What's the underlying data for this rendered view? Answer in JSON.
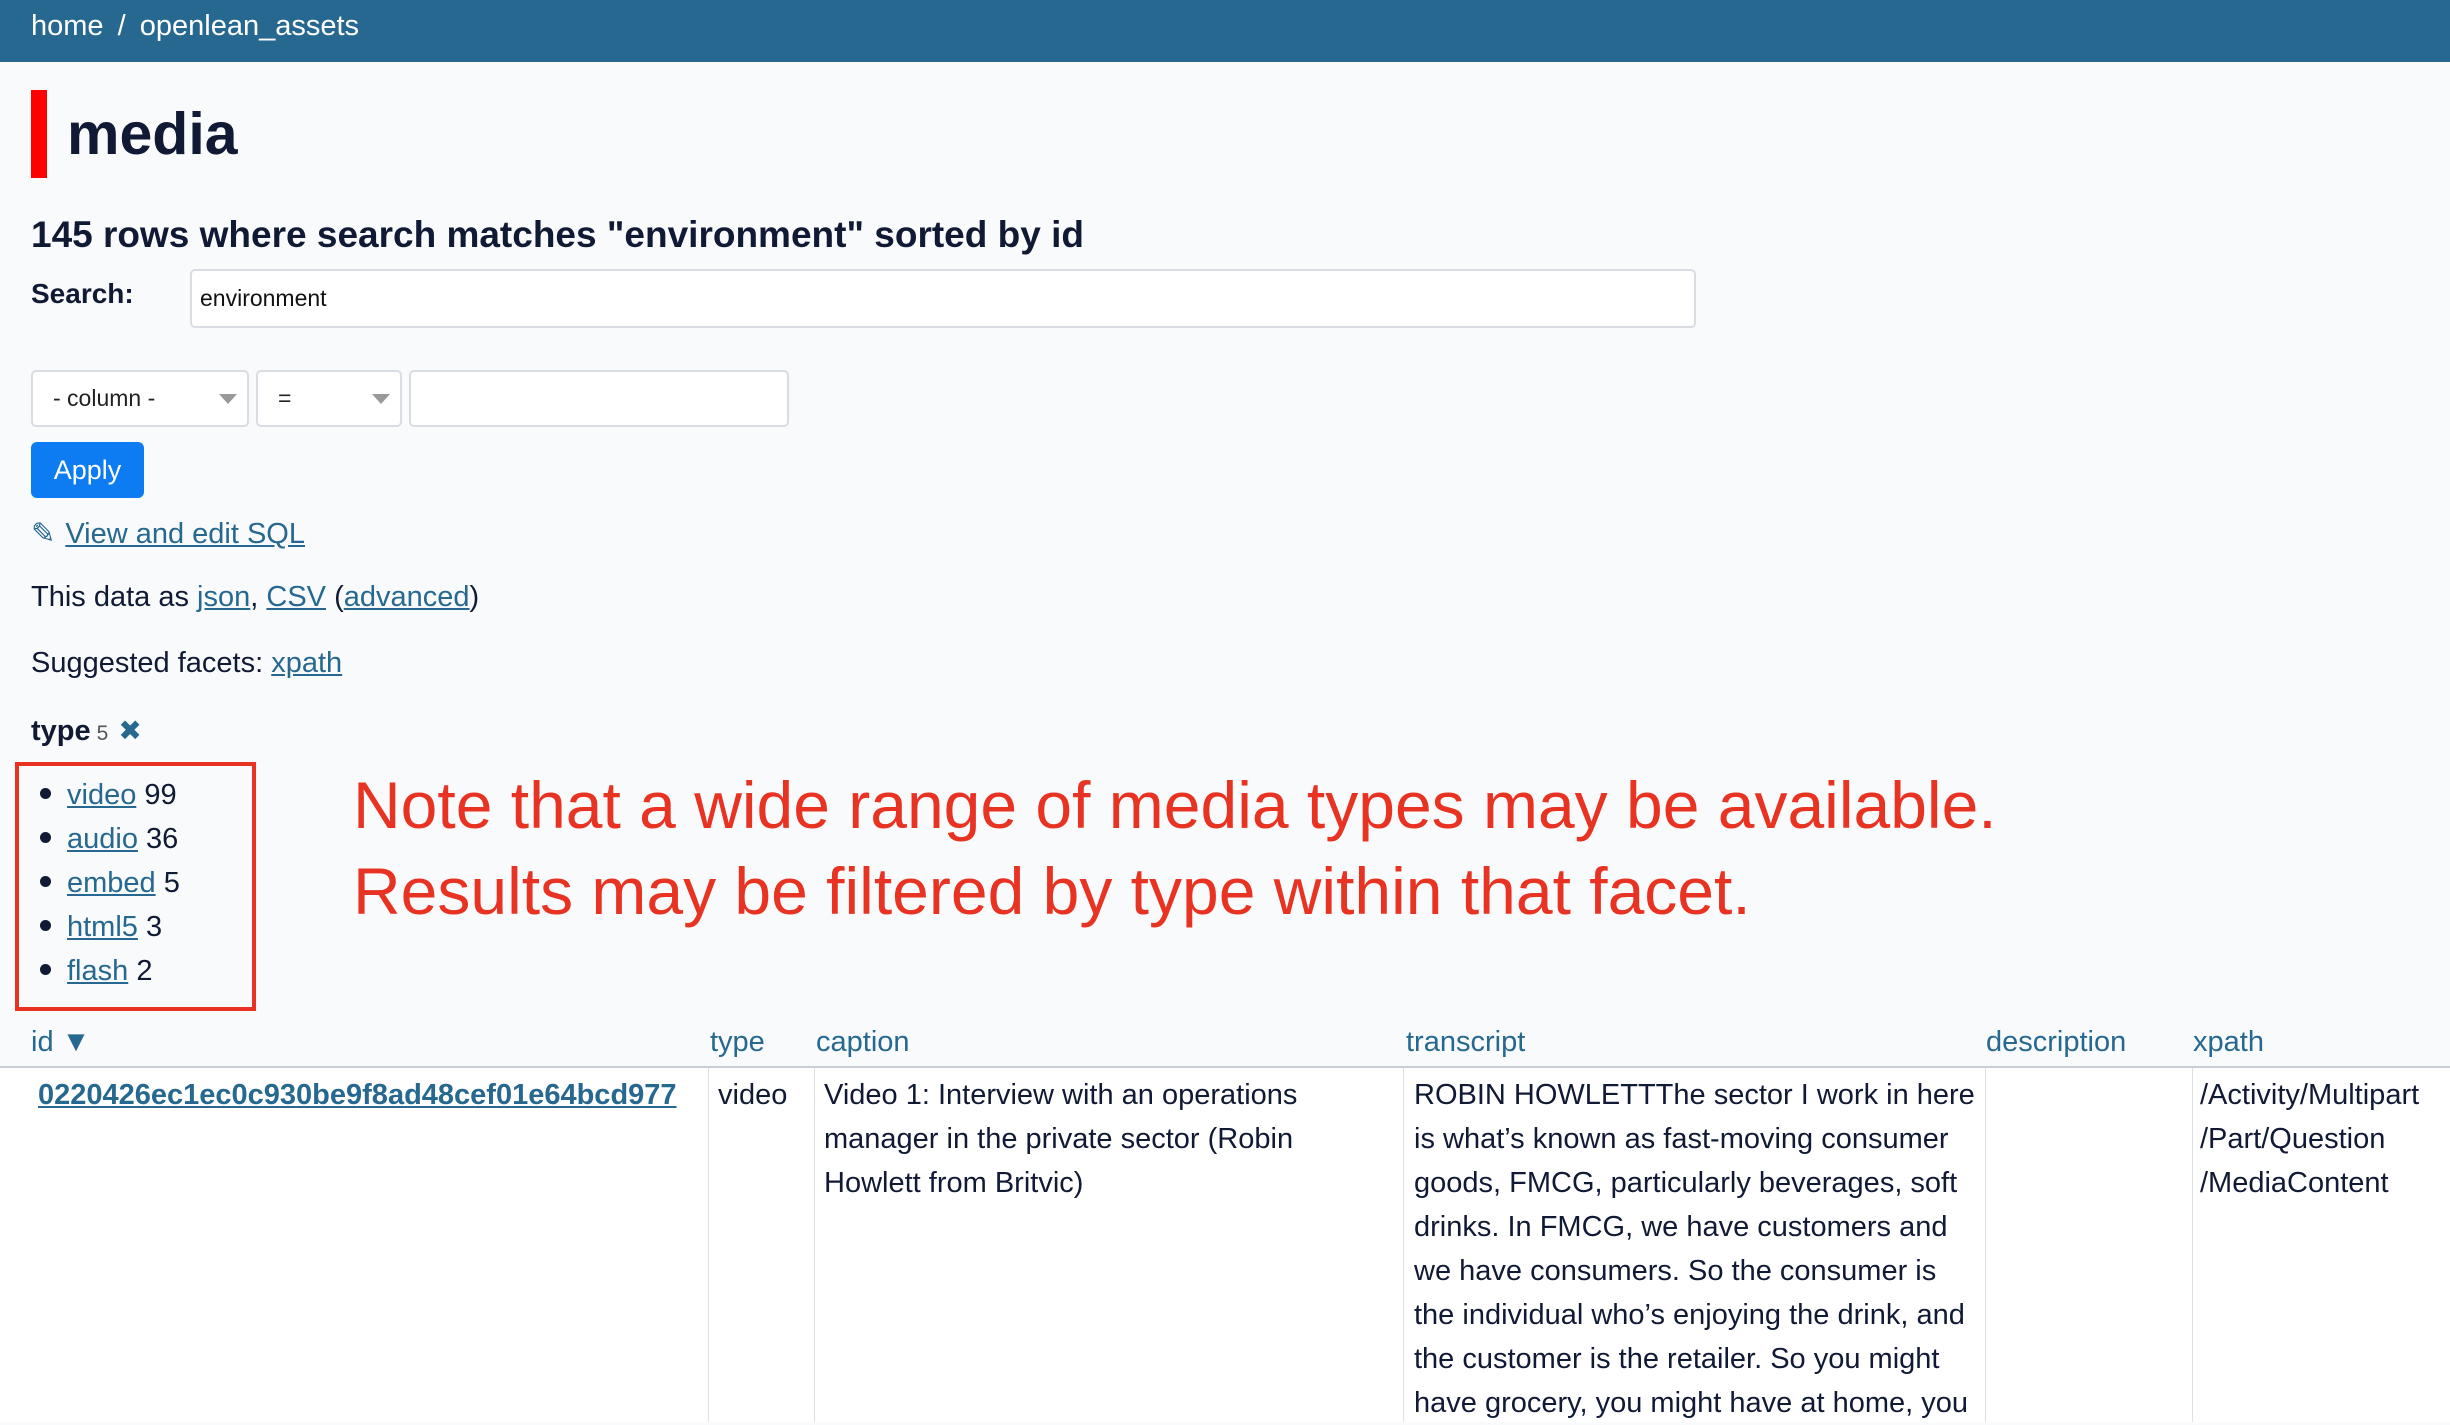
{
  "breadcrumb": {
    "home": "home",
    "separator": "/",
    "database": "openlean_assets"
  },
  "page_title": "media",
  "row_count_text": "145 rows where search matches \"environment\" sorted by id",
  "search": {
    "label": "Search:",
    "value": "environment"
  },
  "filter": {
    "column_select": "- column -",
    "operator_select": "=",
    "value": ""
  },
  "apply_label": "Apply",
  "sql": {
    "pencil": "✎",
    "link": "View and edit SQL"
  },
  "export": {
    "prefix": "This data as",
    "json": "json",
    "comma": ",",
    "csv": "CSV",
    "open_paren": "(",
    "advanced": "advanced",
    "close_paren": ")"
  },
  "suggested_facets": {
    "label": "Suggested facets:",
    "xpath": "xpath"
  },
  "facet": {
    "name": "type",
    "count": "5",
    "close_glyph": "✖",
    "items": [
      {
        "label": "video",
        "count": "99"
      },
      {
        "label": "audio",
        "count": "36"
      },
      {
        "label": "embed",
        "count": "5"
      },
      {
        "label": "html5",
        "count": "3"
      },
      {
        "label": "flash",
        "count": "2"
      }
    ]
  },
  "annotation": {
    "line1": "Note that a wide range of media types may be available.",
    "line2": "Results may be filtered by type within that facet.",
    "color": "#e83323"
  },
  "table": {
    "columns": [
      "id ▼",
      "type",
      "caption",
      "transcript",
      "description",
      "xpath"
    ],
    "row": {
      "id": "0220426ec1ec0c930be9f8ad48cef01e64bcd977",
      "type": "video",
      "caption": [
        "Video 1: Interview with an operations",
        "manager in the private sector (Robin",
        "Howlett from Britvic)"
      ],
      "transcript": [
        "ROBIN HOWLETTThe sector I work in here",
        "is what’s known as fast-moving consumer",
        "goods, FMCG, particularly beverages, soft",
        "drinks. In FMCG, we have customers and",
        "we have consumers. So the consumer is",
        "the individual who’s enjoying the drink, and",
        "the customer is the retailer. So you might",
        "have grocery, you might have at home, you"
      ],
      "description": "",
      "xpath": [
        "/Activity/Multipart",
        "/Part/Question",
        "/MediaContent"
      ]
    }
  },
  "colors": {
    "header": "#276890",
    "link": "#276890",
    "title_accent": "#ff0000",
    "apply_button": "#0d7cf2"
  }
}
